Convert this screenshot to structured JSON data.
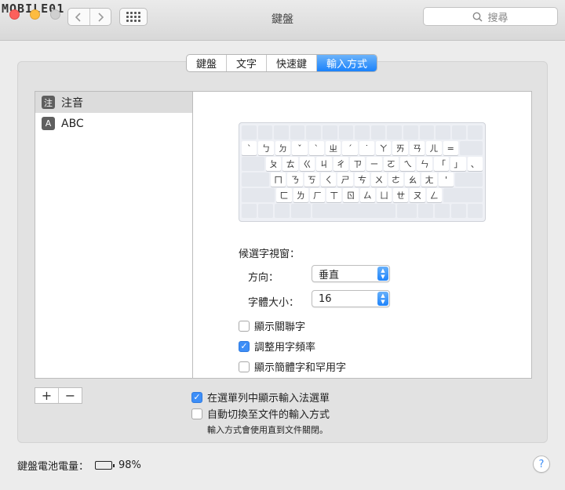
{
  "watermark": "MOBILE01",
  "window": {
    "title": "鍵盤"
  },
  "toolbar": {
    "back_icon": "chevron-left-icon",
    "forward_icon": "chevron-right-icon",
    "grid_icon": "grid-icon"
  },
  "search": {
    "placeholder": "搜尋"
  },
  "tabs": [
    {
      "label": "鍵盤",
      "active": false
    },
    {
      "label": "文字",
      "active": false
    },
    {
      "label": "快速鍵",
      "active": false
    },
    {
      "label": "輸入方式",
      "active": true
    }
  ],
  "input_sources": [
    {
      "badge": "注",
      "label": "注音",
      "selected": true
    },
    {
      "badge": "A",
      "label": "ABC",
      "selected": false
    }
  ],
  "list_buttons": {
    "add": "+",
    "remove": "−"
  },
  "keyboard": {
    "rows": [
      [
        "",
        "",
        "",
        "",
        "",
        "",
        "",
        "",
        "",
        "",
        "",
        "",
        "",
        "",
        ""
      ],
      [
        "ˋ",
        "ㄅ",
        "ㄉ",
        "ˇ",
        "ˋ",
        "ㄓ",
        "ˊ",
        "˙",
        "ㄚ",
        "ㄞ",
        "ㄢ",
        "ㄦ",
        "="
      ],
      [
        "ㄆ",
        "ㄊ",
        "ㄍ",
        "ㄐ",
        "ㄔ",
        "ㄗ",
        "ㄧ",
        "ㄛ",
        "ㄟ",
        "ㄣ",
        "「",
        "」",
        "、"
      ],
      [
        "ㄇ",
        "ㄋ",
        "ㄎ",
        "ㄑ",
        "ㄕ",
        "ㄘ",
        "ㄨ",
        "ㄜ",
        "ㄠ",
        "ㄤ",
        "'"
      ],
      [
        "ㄈ",
        "ㄌ",
        "ㄏ",
        "ㄒ",
        "ㄖ",
        "ㄙ",
        "ㄩ",
        "ㄝ",
        "ㄡ",
        "ㄥ"
      ]
    ]
  },
  "candidate": {
    "heading": "候選字視窗：",
    "direction_label": "方向：",
    "direction_value": "垂直",
    "fontsize_label": "字體大小：",
    "fontsize_value": "16"
  },
  "options": [
    {
      "label": "顯示關聯字",
      "checked": false
    },
    {
      "label": "調整用字頻率",
      "checked": true
    },
    {
      "label": "顯示簡體字和罕用字",
      "checked": false
    }
  ],
  "bottom_options": [
    {
      "label": "在選單列中顯示輸入法選單",
      "checked": true
    },
    {
      "label": "自動切換至文件的輸入方式",
      "checked": false
    }
  ],
  "bottom_note": "輸入方式會使用直到文件關閉。",
  "battery": {
    "label": "鍵盤電池電量：",
    "level_percent": 98,
    "value": "98%"
  },
  "help": "?",
  "colors": {
    "accent": "#1a82fb",
    "close": "#fc605c",
    "minimize": "#fdbc40"
  }
}
